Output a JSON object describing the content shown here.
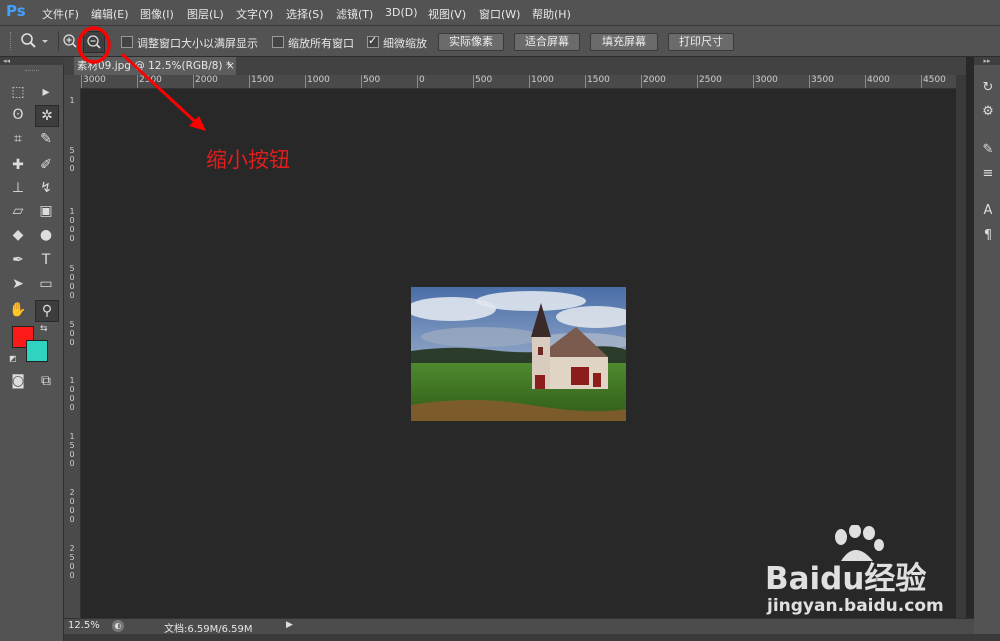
{
  "app": {
    "logo": "Ps"
  },
  "menu": [
    {
      "id": "file",
      "label": "文件(F)"
    },
    {
      "id": "edit",
      "label": "编辑(E)"
    },
    {
      "id": "image",
      "label": "图像(I)"
    },
    {
      "id": "layer",
      "label": "图层(L)"
    },
    {
      "id": "type",
      "label": "文字(Y)"
    },
    {
      "id": "select",
      "label": "选择(S)"
    },
    {
      "id": "filter",
      "label": "滤镜(T)"
    },
    {
      "id": "3d",
      "label": "3D(D)"
    },
    {
      "id": "view",
      "label": "视图(V)"
    },
    {
      "id": "window",
      "label": "窗口(W)"
    },
    {
      "id": "help",
      "label": "帮助(H)"
    }
  ],
  "options": {
    "resize_windows_label": "调整窗口大小以满屏显示",
    "resize_windows_checked": false,
    "zoom_all_label": "缩放所有窗口",
    "zoom_all_checked": false,
    "scrubby_label": "细微缩放",
    "scrubby_checked": true,
    "actual_pixels": "实际像素",
    "fit_screen": "适合屏幕",
    "fill_screen": "填充屏幕",
    "print_size": "打印尺寸"
  },
  "document": {
    "tab_title": "素材09.jpg @ 12.5%(RGB/8) *",
    "close_glyph": "×"
  },
  "ruler": {
    "h_labels": [
      "3000",
      "2500",
      "2000",
      "1500",
      "1000",
      "500",
      "0",
      "500",
      "1000",
      "1500",
      "2000",
      "2500",
      "3000",
      "3500",
      "4000",
      "4500"
    ],
    "v_labels": [
      "1",
      "5",
      "0",
      "0",
      "1",
      "0",
      "0",
      "0",
      "5",
      "0",
      "0",
      "0",
      "5",
      "0",
      "0",
      "1",
      "0",
      "0",
      "0",
      "1",
      "5",
      "0",
      "0",
      "2",
      "0",
      "0",
      "0",
      "2",
      "5",
      "0",
      "0"
    ]
  },
  "status": {
    "zoom": "12.5%",
    "doc_info": "文档:6.59M/6.59M",
    "arrow": "▶"
  },
  "annotation": {
    "label": "缩小按钮",
    "color": "#e01e1e"
  },
  "watermark": {
    "brand": "Baidu经验",
    "url": "jingyan.baidu.com"
  },
  "colors": {
    "foreground": "#ff1a1a",
    "background": "#2fd3c0"
  }
}
